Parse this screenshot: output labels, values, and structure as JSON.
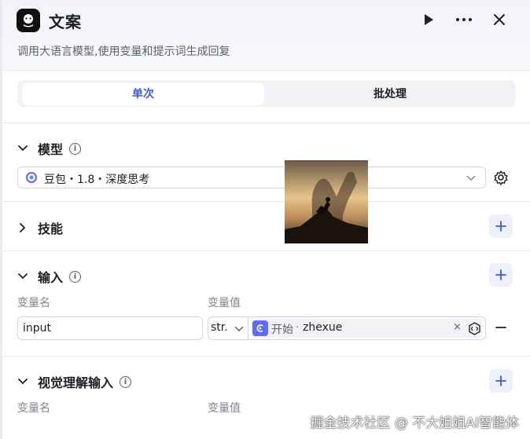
{
  "header": {
    "title": "文案",
    "subtitle": "调用大语言模型,使用变量和提示词生成回复",
    "icons": {
      "run": "play-icon",
      "more": "more-icon",
      "close": "close-icon"
    }
  },
  "tabs": [
    {
      "label": "单次",
      "active": true
    },
    {
      "label": "批处理",
      "active": false
    }
  ],
  "model_section": {
    "title": "模型",
    "selected_model": "豆包・1.8・深度思考"
  },
  "skills_section": {
    "title": "技能"
  },
  "input_section": {
    "title": "输入",
    "col_name": "变量名",
    "col_value": "变量值",
    "rows": [
      {
        "name": "input",
        "type": "str.",
        "source_node": "开始",
        "source_var": "zhexue"
      }
    ]
  },
  "vision_section": {
    "title": "视觉理解输入",
    "col_name": "变量名",
    "col_value": "变量值"
  },
  "watermark": "掘金技术社区 @ 不大姐姐AI智能体",
  "colors": {
    "accent": "#3b5bdb",
    "header_bg": "#f3f4fb",
    "node_badge": "#5b6ef5"
  }
}
